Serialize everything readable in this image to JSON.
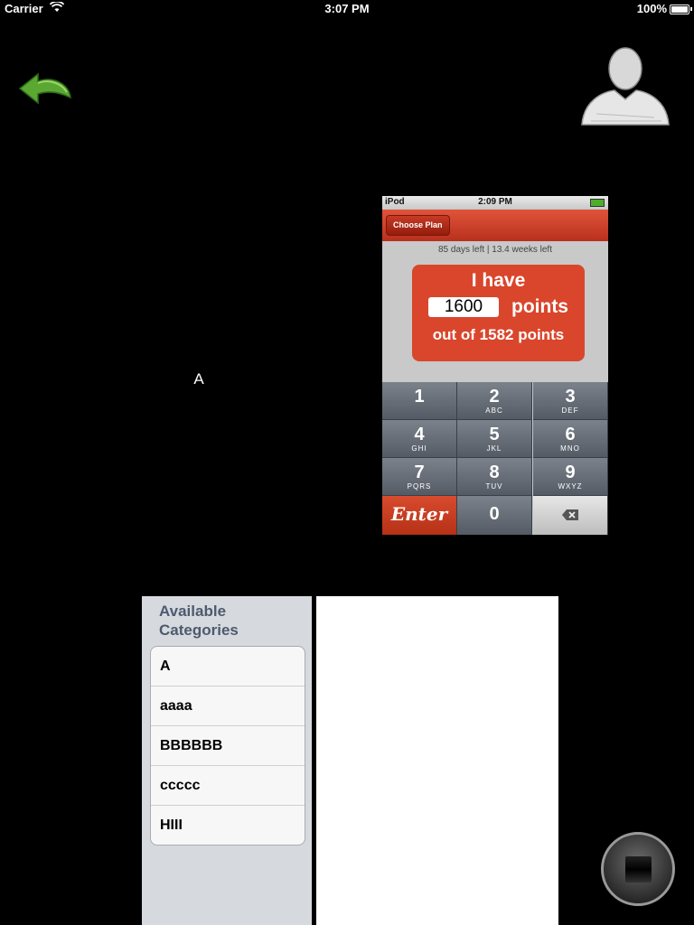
{
  "status_bar": {
    "carrier": "Carrier",
    "time": "3:07 PM",
    "battery": "100%"
  },
  "icons": {
    "back": "back-arrow-icon",
    "profile": "person-silhouette-icon",
    "stop": "stop-icon",
    "backspace": "backspace-icon"
  },
  "center_label": "A",
  "phone_preview": {
    "status": {
      "carrier": "iPod",
      "time": "2:09 PM"
    },
    "nav_button": "Choose Plan",
    "days_left": "85 days left  |  13.4 weeks left",
    "have_label": "I have",
    "points_value": "1600",
    "points_label": "points",
    "out_of": "out of 1582 points",
    "keys": [
      {
        "num": "1",
        "sub": ""
      },
      {
        "num": "2",
        "sub": "ABC"
      },
      {
        "num": "3",
        "sub": "DEF"
      },
      {
        "num": "4",
        "sub": "GHI"
      },
      {
        "num": "5",
        "sub": "JKL"
      },
      {
        "num": "6",
        "sub": "MNO"
      },
      {
        "num": "7",
        "sub": "PQRS"
      },
      {
        "num": "8",
        "sub": "TUV"
      },
      {
        "num": "9",
        "sub": "WXYZ"
      }
    ],
    "enter_label": "Enter",
    "zero_label": "0"
  },
  "categories": {
    "header_line1": "Available",
    "header_line2": "Categories",
    "items": [
      "A",
      "aaaa",
      "BBBBBB",
      "ccccc",
      "HIII"
    ]
  },
  "colors": {
    "accent_red": "#d9462c",
    "back_green": "#5aa832"
  }
}
